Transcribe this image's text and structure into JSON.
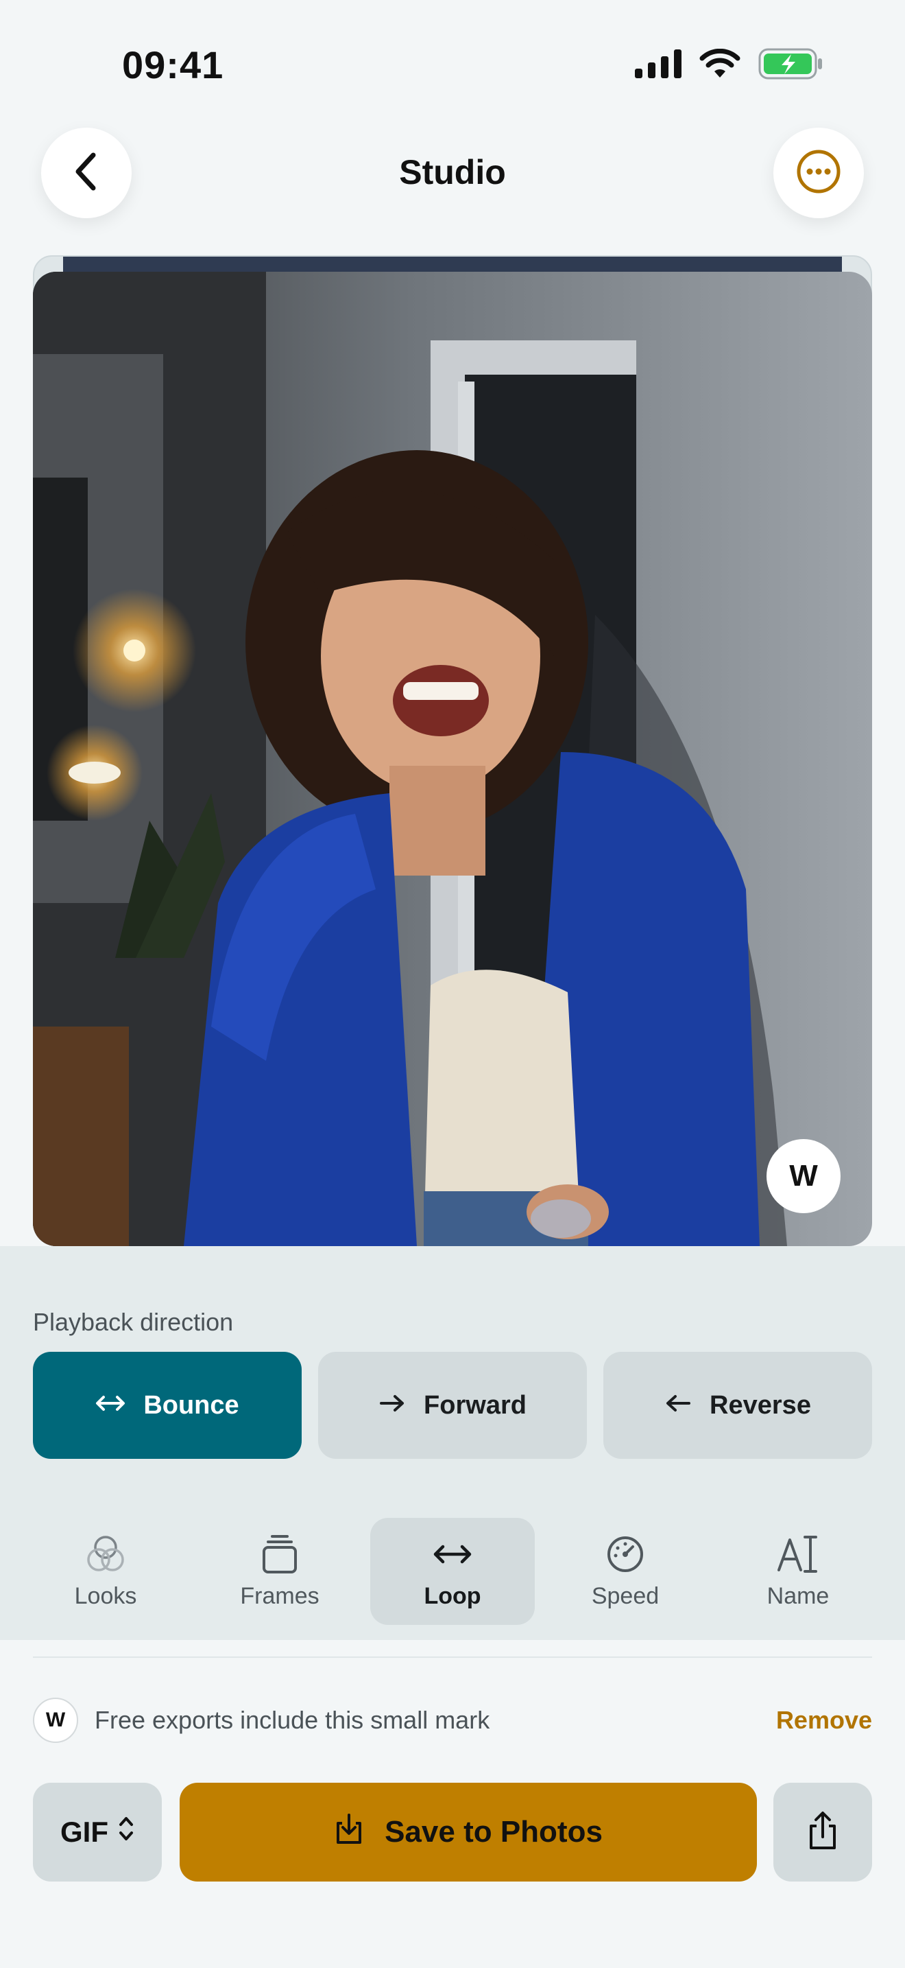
{
  "status_bar": {
    "time": "09:41"
  },
  "header": {
    "title": "Studio"
  },
  "preview": {
    "watermark_badge": "W"
  },
  "playback": {
    "label": "Playback direction",
    "options": [
      {
        "label": "Bounce",
        "icon": "bidirectional-arrow-icon",
        "selected": true
      },
      {
        "label": "Forward",
        "icon": "arrow-right-icon",
        "selected": false
      },
      {
        "label": "Reverse",
        "icon": "arrow-left-icon",
        "selected": false
      }
    ]
  },
  "toolbar": {
    "items": [
      {
        "label": "Looks",
        "icon": "looks-icon",
        "selected": false
      },
      {
        "label": "Frames",
        "icon": "frames-icon",
        "selected": false
      },
      {
        "label": "Loop",
        "icon": "loop-icon",
        "selected": true
      },
      {
        "label": "Speed",
        "icon": "speed-icon",
        "selected": false
      },
      {
        "label": "Name",
        "icon": "name-icon",
        "selected": false
      }
    ]
  },
  "watermark_notice": {
    "badge": "W",
    "text": "Free exports include this small mark",
    "action": "Remove"
  },
  "actions": {
    "format": "GIF",
    "save_label": "Save to Photos"
  },
  "colors": {
    "accent_teal": "#00687a",
    "accent_gold": "#bf7f00",
    "link_gold": "#b17400",
    "background": "#f3f6f7"
  }
}
